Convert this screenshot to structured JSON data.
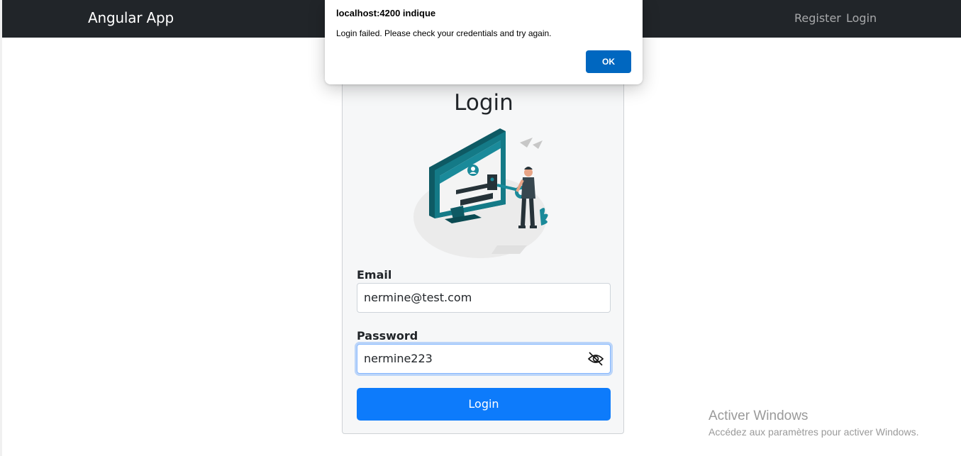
{
  "navbar": {
    "brand": "Angular App",
    "links": [
      "Register",
      "Login"
    ]
  },
  "login_card": {
    "title": "Login",
    "email_label": "Email",
    "email_value": "nermine@test.com",
    "password_label": "Password",
    "password_value": "nermine223",
    "submit_label": "Login"
  },
  "alert_dialog": {
    "title": "localhost:4200 indique",
    "message": "Login failed. Please check your credentials and try again.",
    "ok_label": "OK"
  },
  "windows_watermark": {
    "title": "Activer Windows",
    "subtitle": "Accédez aux paramètres pour activer Windows."
  },
  "colors": {
    "navbar_bg": "#212529",
    "primary": "#0d7bfb",
    "dialog_button": "#0067c0",
    "illustration_accent": "#1a8a9a"
  },
  "icons": {
    "password_toggle": "eye-slash-icon",
    "illustration": "user-login-illustration"
  }
}
